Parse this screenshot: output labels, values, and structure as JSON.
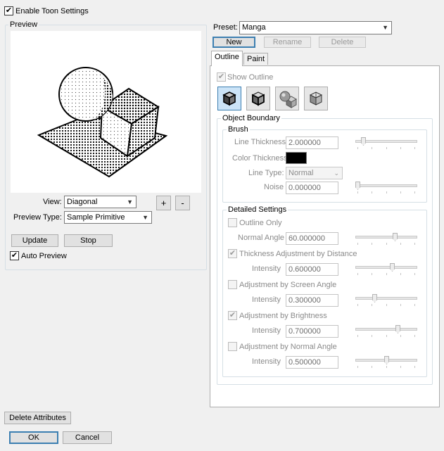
{
  "enable_toon": {
    "label": "Enable Toon Settings",
    "checked": true
  },
  "preview": {
    "title": "Preview",
    "view_label": "View:",
    "view_value": "Diagonal",
    "zoom_in": "+",
    "zoom_out": "-",
    "preview_type_label": "Preview Type:",
    "preview_type_value": "Sample Primitive",
    "update_label": "Update",
    "stop_label": "Stop",
    "auto_preview_label": "Auto Preview",
    "auto_preview_checked": true
  },
  "preset": {
    "label": "Preset:",
    "value": "Manga",
    "new_label": "New",
    "rename_label": "Rename",
    "delete_label": "Delete"
  },
  "tabs": [
    {
      "label": "Outline",
      "active": true
    },
    {
      "label": "Paint",
      "active": false
    }
  ],
  "outline": {
    "show_outline_label": "Show Outline",
    "icons": [
      "cube-outline-icon",
      "cube-silhouette-icon",
      "sphere-cube-icon",
      "cube-wireframe-icon"
    ],
    "object_boundary": {
      "title": "Object Boundary",
      "brush": {
        "title": "Brush",
        "line_thickness_label": "Line Thickness",
        "line_thickness_value": "2.000000",
        "line_thickness_slider": 0.1,
        "color_thickness_label": "Color Thickness",
        "color_thickness_color": "#000000",
        "line_type_label": "Line Type:",
        "line_type_value": "Normal",
        "noise_label": "Noise",
        "noise_value": "0.000000",
        "noise_slider": 0.0
      }
    },
    "detailed": {
      "title": "Detailed Settings",
      "outline_only_label": "Outline Only",
      "normal_angle_label": "Normal Angle",
      "normal_angle_value": "60.000000",
      "normal_angle_slider": 0.65,
      "thickness_adj_label": "Thickness Adjustment by Distance",
      "intensity_label": "Intensity",
      "thickness_adj_value": "0.600000",
      "thickness_adj_slider": 0.6,
      "screen_angle_label": "Adjustment by Screen Angle",
      "screen_angle_value": "0.300000",
      "screen_angle_slider": 0.3,
      "brightness_label": "Adjustment by Brightness",
      "brightness_value": "0.700000",
      "brightness_slider": 0.7,
      "normal_angle_adj_label": "Adjustment by Normal Angle",
      "normal_angle_adj_value": "0.500000",
      "normal_angle_adj_slider": 0.5
    }
  },
  "footer": {
    "delete_attributes_label": "Delete Attributes",
    "ok_label": "OK",
    "cancel_label": "Cancel"
  }
}
